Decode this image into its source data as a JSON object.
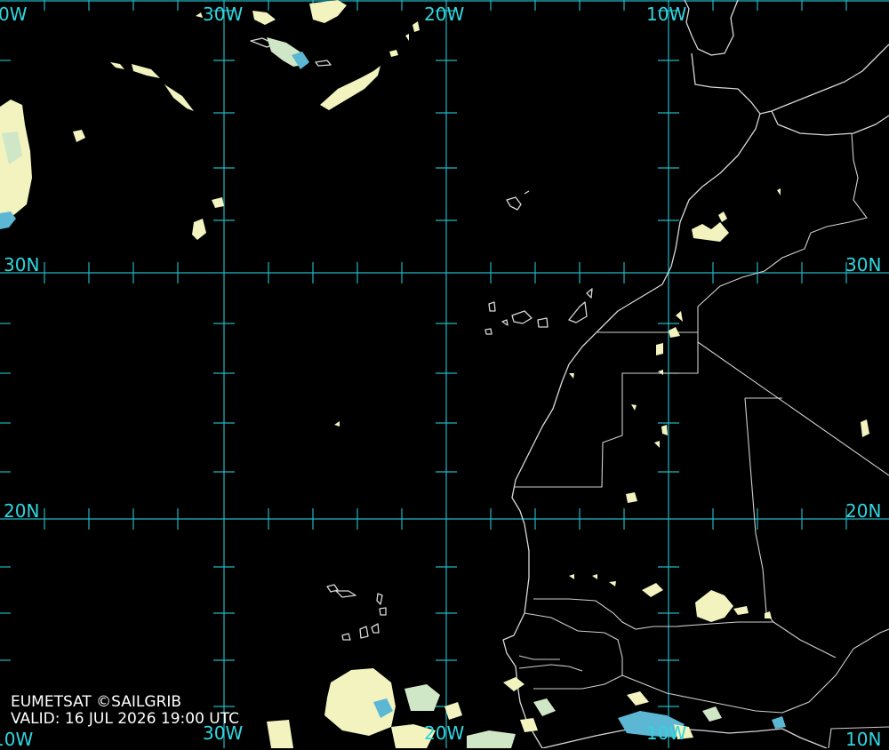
{
  "labels": {
    "lon_top": [
      "0W",
      "30W",
      "20W",
      "10W"
    ],
    "lon_bottom": [
      "10W",
      "30W",
      "20W",
      "10W",
      "10N"
    ],
    "lat_left": [
      "30N",
      "20N"
    ],
    "lat_right": [
      "30N",
      "20N"
    ]
  },
  "footer": {
    "credit": "EUMETSAT ©SAILGRIB",
    "valid": "VALID:  16 JUL 2026 19:00 UTC"
  },
  "colors": {
    "background": "#000000",
    "grid": "#1fb8c4",
    "label": "#2fd6e0",
    "coastline": "#d8d8d8",
    "cloud_low": "#f2f3bf",
    "cloud_mid": "#cfe7c6",
    "cloud_high": "#5bb7d4"
  }
}
